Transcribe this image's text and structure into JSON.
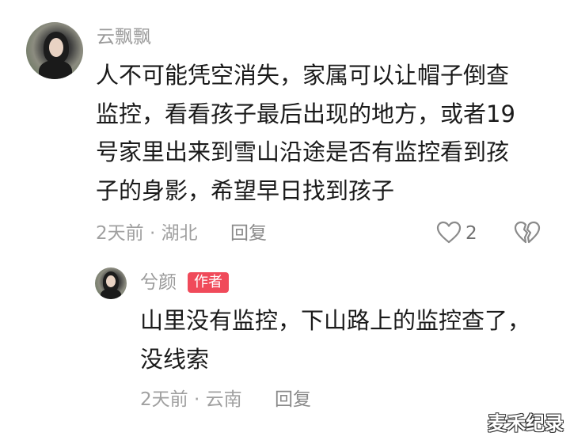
{
  "comment": {
    "username": "云飘飘",
    "text_lines": [
      "人不可能凭空消失，家属可以让帽子倒查",
      "监控，看看孩子最后出现的地方，或者19",
      "号家里出来到雪山沿途是否有监控看到孩",
      "子的身影，希望早日找到孩子"
    ],
    "meta": "2天前 · 湖北",
    "reply_label": "回复",
    "like_count": "2",
    "like_icon": "heart-outline-icon",
    "dislike_icon": "broken-heart-icon"
  },
  "reply": {
    "username": "兮颜",
    "badge": "作者",
    "text_lines": [
      "山里没有监控，下山路上的监控查了，",
      "没线索"
    ],
    "meta": "2天前 · 云南",
    "reply_label": "回复"
  },
  "watermark": "麦禾纪录"
}
